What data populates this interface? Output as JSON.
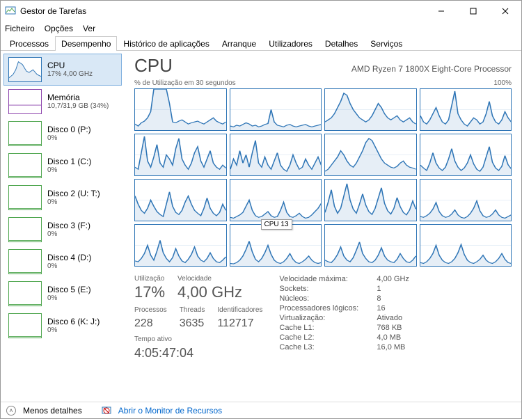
{
  "window": {
    "title": "Gestor de Tarefas"
  },
  "menu": {
    "items": [
      "Ficheiro",
      "Opções",
      "Ver"
    ]
  },
  "tabs": {
    "items": [
      "Processos",
      "Desempenho",
      "Histórico de aplicações",
      "Arranque",
      "Utilizadores",
      "Detalhes",
      "Serviços"
    ],
    "active_index": 1
  },
  "sidebar": {
    "items": [
      {
        "title": "CPU",
        "sub": "17% 4,00 GHz",
        "color": "#2e75b6",
        "sel": true
      },
      {
        "title": "Memória",
        "sub": "10,7/31,9 GB (34%)",
        "color": "#8e44ad",
        "sel": false
      },
      {
        "title": "Disco 0 (P:)",
        "sub": "0%",
        "color": "#4fa64f",
        "sel": false
      },
      {
        "title": "Disco 1 (C:)",
        "sub": "0%",
        "color": "#4fa64f",
        "sel": false
      },
      {
        "title": "Disco 2 (U: T:)",
        "sub": "0%",
        "color": "#4fa64f",
        "sel": false
      },
      {
        "title": "Disco 3 (F:)",
        "sub": "0%",
        "color": "#4fa64f",
        "sel": false
      },
      {
        "title": "Disco 4 (D:)",
        "sub": "0%",
        "color": "#4fa64f",
        "sel": false
      },
      {
        "title": "Disco 5 (E:)",
        "sub": "0%",
        "color": "#4fa64f",
        "sel": false
      },
      {
        "title": "Disco 6 (K: J:)",
        "sub": "0%",
        "color": "#4fa64f",
        "sel": false
      }
    ]
  },
  "detail": {
    "title": "CPU",
    "subtitle": "AMD Ryzen 7 1800X Eight-Core Processor",
    "graph_header_left": "% de Utilização em 30 segundos",
    "graph_header_right": "100%",
    "tooltip_text": "CPU 13",
    "stats_big": [
      {
        "lbl": "Utilização",
        "val": "17%"
      },
      {
        "lbl": "Velocidade",
        "val": "4,00 GHz"
      }
    ],
    "stats_mid": [
      {
        "lbl": "Processos",
        "val": "228"
      },
      {
        "lbl": "Threads",
        "val": "3635"
      },
      {
        "lbl": "Identificadores",
        "val": "112717"
      }
    ],
    "uptime_lbl": "Tempo ativo",
    "uptime_val": "4:05:47:04",
    "specs": [
      [
        "Velocidade máxima:",
        "4,00 GHz"
      ],
      [
        "Sockets:",
        "1"
      ],
      [
        "Núcleos:",
        "8"
      ],
      [
        "Processadores lógicos:",
        "16"
      ],
      [
        "Virtualização:",
        "Ativado"
      ],
      [
        "Cache L1:",
        "768 KB"
      ],
      [
        "Cache L2:",
        "4,0 MB"
      ],
      [
        "Cache L3:",
        "16,0 MB"
      ]
    ]
  },
  "footer": {
    "fewer": "Menos detalhes",
    "resmon": "Abrir o Monitor de Recursos"
  },
  "chart_data": {
    "type": "line",
    "note": "16 mini sparklines of per-logical-CPU utilization over last 30s, y range 0–100%",
    "ylim": [
      0,
      100
    ],
    "timespan_seconds": 30,
    "series": [
      {
        "name": "CPU0",
        "values": [
          15,
          10,
          18,
          22,
          30,
          45,
          100,
          100,
          100,
          100,
          100,
          65,
          20,
          18,
          22,
          25,
          20,
          15,
          18,
          20,
          22,
          18,
          15,
          20,
          25,
          30,
          22,
          18,
          15,
          20
        ]
      },
      {
        "name": "CPU1",
        "values": [
          10,
          8,
          12,
          10,
          14,
          18,
          15,
          10,
          12,
          8,
          10,
          14,
          16,
          50,
          20,
          12,
          10,
          8,
          12,
          14,
          10,
          8,
          10,
          12,
          14,
          10,
          8,
          10,
          12,
          14
        ]
      },
      {
        "name": "CPU2",
        "values": [
          20,
          25,
          30,
          40,
          55,
          70,
          90,
          85,
          65,
          50,
          40,
          30,
          25,
          20,
          25,
          35,
          50,
          65,
          55,
          40,
          30,
          25,
          30,
          35,
          25,
          20,
          25,
          30,
          20,
          15
        ]
      },
      {
        "name": "CPU3",
        "values": [
          35,
          20,
          15,
          25,
          40,
          55,
          35,
          20,
          15,
          25,
          60,
          95,
          40,
          25,
          15,
          10,
          20,
          30,
          25,
          15,
          20,
          40,
          70,
          35,
          20,
          15,
          25,
          45,
          30,
          20
        ]
      },
      {
        "name": "CPU4",
        "values": [
          20,
          15,
          55,
          95,
          35,
          20,
          45,
          75,
          30,
          20,
          50,
          40,
          25,
          65,
          90,
          40,
          25,
          15,
          30,
          55,
          70,
          35,
          20,
          40,
          60,
          30,
          20,
          15,
          25,
          18
        ]
      },
      {
        "name": "CPU5",
        "values": [
          15,
          40,
          25,
          60,
          30,
          50,
          20,
          55,
          85,
          30,
          20,
          45,
          25,
          15,
          35,
          55,
          25,
          15,
          10,
          25,
          50,
          30,
          15,
          20,
          40,
          25,
          15,
          30,
          45,
          25
        ]
      },
      {
        "name": "CPU6",
        "values": [
          10,
          15,
          25,
          35,
          45,
          60,
          50,
          35,
          25,
          20,
          30,
          45,
          60,
          80,
          90,
          85,
          70,
          55,
          40,
          30,
          25,
          20,
          18,
          22,
          30,
          35,
          25,
          20,
          18,
          15
        ]
      },
      {
        "name": "CPU7",
        "values": [
          25,
          18,
          12,
          30,
          55,
          30,
          18,
          12,
          20,
          40,
          65,
          35,
          20,
          12,
          18,
          30,
          50,
          28,
          15,
          10,
          20,
          45,
          70,
          32,
          18,
          12,
          22,
          48,
          26,
          16
        ]
      },
      {
        "name": "CPU8",
        "values": [
          60,
          40,
          25,
          18,
          30,
          50,
          35,
          22,
          15,
          10,
          40,
          70,
          35,
          20,
          15,
          25,
          45,
          60,
          40,
          25,
          18,
          12,
          30,
          55,
          30,
          18,
          12,
          20,
          40,
          25
        ]
      },
      {
        "name": "CPU9",
        "values": [
          8,
          6,
          10,
          14,
          20,
          35,
          50,
          25,
          12,
          8,
          10,
          16,
          22,
          12,
          8,
          10,
          25,
          45,
          20,
          10,
          8,
          12,
          18,
          10,
          6,
          8,
          14,
          22,
          30,
          42
        ]
      },
      {
        "name": "CPU10",
        "values": [
          20,
          45,
          75,
          35,
          18,
          30,
          60,
          90,
          50,
          28,
          18,
          40,
          65,
          38,
          22,
          15,
          30,
          55,
          80,
          42,
          24,
          16,
          30,
          56,
          34,
          20,
          14,
          26,
          48,
          28
        ]
      },
      {
        "name": "CPU11",
        "values": [
          10,
          8,
          12,
          18,
          28,
          44,
          22,
          12,
          8,
          10,
          16,
          26,
          14,
          8,
          6,
          10,
          18,
          30,
          48,
          24,
          12,
          8,
          10,
          16,
          26,
          14,
          8,
          6,
          10,
          14
        ]
      },
      {
        "name": "CPU12",
        "values": [
          12,
          10,
          18,
          30,
          50,
          26,
          14,
          36,
          62,
          32,
          18,
          10,
          20,
          42,
          24,
          12,
          8,
          16,
          28,
          46,
          24,
          14,
          10,
          18,
          32,
          18,
          10,
          8,
          14,
          22
        ]
      },
      {
        "name": "CPU13",
        "values": [
          6,
          5,
          8,
          14,
          24,
          40,
          60,
          34,
          16,
          10,
          18,
          32,
          50,
          28,
          14,
          8,
          6,
          10,
          18,
          30,
          16,
          8,
          6,
          10,
          16,
          24,
          14,
          8,
          6,
          8
        ]
      },
      {
        "name": "CPU14",
        "values": [
          14,
          10,
          8,
          16,
          28,
          46,
          24,
          14,
          10,
          20,
          38,
          58,
          30,
          18,
          10,
          8,
          14,
          26,
          44,
          24,
          14,
          10,
          8,
          16,
          30,
          18,
          10,
          8,
          14,
          24
        ]
      },
      {
        "name": "CPU15",
        "values": [
          8,
          6,
          10,
          18,
          30,
          50,
          26,
          14,
          8,
          6,
          10,
          18,
          32,
          52,
          28,
          14,
          8,
          6,
          10,
          16,
          26,
          14,
          8,
          6,
          10,
          18,
          30,
          16,
          8,
          6
        ]
      }
    ]
  }
}
